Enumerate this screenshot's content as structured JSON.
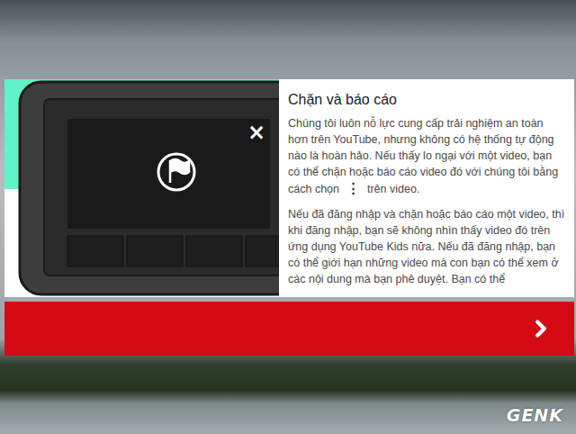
{
  "dialog": {
    "title": "Chặn và báo cáo",
    "close_icon": "×",
    "paragraphs": [
      [
        {
          "kind": "text",
          "text": "Chúng tôi luôn nỗ lực cung cấp trải nghiệm an toàn hơn trên YouTube, nhưng không có hệ thống tự động nào là hoàn hảo. Nếu thấy lo ngại với một video, bạn có thể chặn hoặc báo cáo video đó với chúng tôi bằng cách chọn"
        },
        {
          "kind": "icon",
          "text": "⋮"
        },
        {
          "kind": "text",
          "text": "trên video."
        }
      ],
      [
        {
          "kind": "text",
          "text": "Nếu đã đăng nhập và chặn hoặc báo cáo một video, thì khi đăng nhập, bạn sẽ không nhìn thấy video đó trên ứng dụng YouTube Kids nữa. Nếu đã đăng nhập, bạn có thể giới hạn những video mà con bạn có thể xem ở các nội dung mà bạn phê duyệt. Bạn có thể"
        }
      ]
    ]
  },
  "watermark": "GENK"
}
